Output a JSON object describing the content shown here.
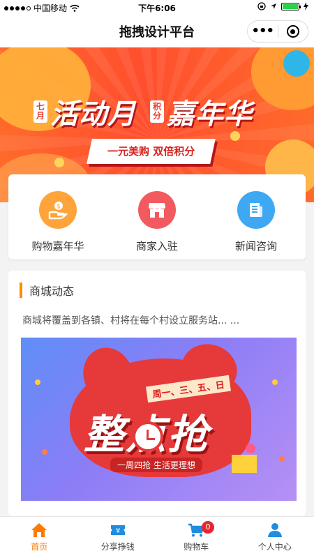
{
  "status_bar": {
    "carrier": "中国移动",
    "time": "下午6:06"
  },
  "navbar": {
    "title": "拖拽设计平台",
    "menu_icon": "more-dots-icon",
    "close_icon": "target-close-icon"
  },
  "banner": {
    "tag1": "七月",
    "headline1": "活动月",
    "tag2": "积分",
    "headline2": "嘉年华",
    "ribbon": "一元美购  双倍积分"
  },
  "quick_menu": [
    {
      "label": "购物嘉年华",
      "icon": "money-hand-icon",
      "color": "#ffa43a"
    },
    {
      "label": "商家入驻",
      "icon": "shop-icon",
      "color": "#f25a5f"
    },
    {
      "label": "新闻咨询",
      "icon": "news-icon",
      "color": "#3fa8f2"
    }
  ],
  "news": {
    "title": "商城动态",
    "summary": "商城将覆盖到各镇、村将在每个村设立服务站... ...",
    "poster": {
      "days": "周一、三、五、日",
      "main": "整点抢",
      "sub": "一周四抢 生活更理想"
    }
  },
  "tabbar": [
    {
      "label": "首页",
      "icon": "home-icon",
      "active": true
    },
    {
      "label": "分享挣钱",
      "icon": "ticket-yen-icon",
      "active": false
    },
    {
      "label": "购物车",
      "icon": "cart-icon",
      "active": false,
      "badge": "0"
    },
    {
      "label": "个人中心",
      "icon": "user-icon",
      "active": false
    }
  ],
  "colors": {
    "accent": "#ff7a00",
    "tab_icon": "#1f8de0",
    "badge": "#e5262f"
  }
}
